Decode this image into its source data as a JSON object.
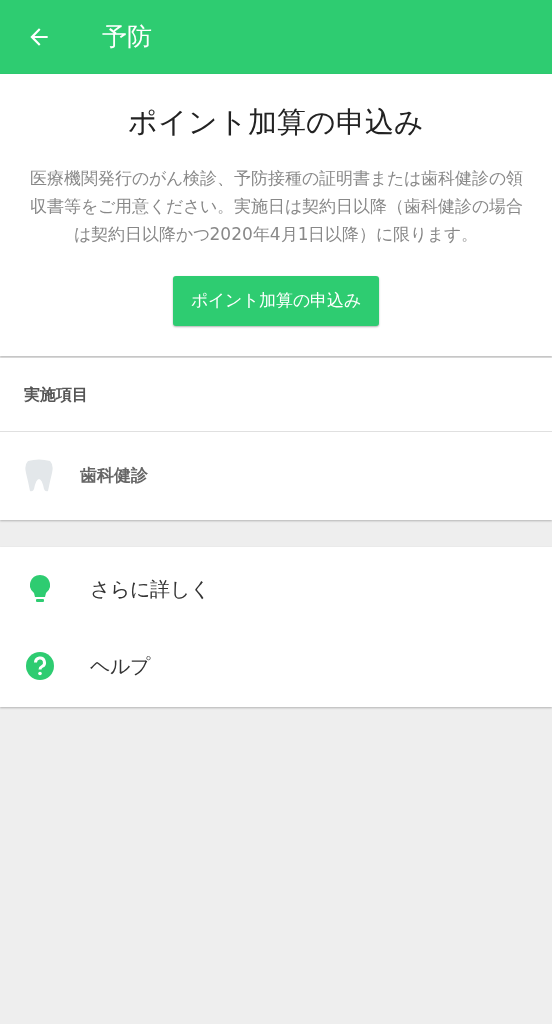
{
  "header": {
    "title": "予防"
  },
  "application": {
    "title": "ポイント加算の申込み",
    "description": "医療機関発行のがん検診、予防接種の証明書または歯科健診の領収書等をご用意ください。実施日は契約日以降（歯科健診の場合は契約日以降かつ2020年4月1日以降）に限ります。",
    "button": "ポイント加算の申込み"
  },
  "items_section": {
    "heading": "実施項目",
    "items": [
      {
        "label": "歯科健診"
      }
    ]
  },
  "menu": [
    {
      "kind": "tip",
      "label": "さらに詳しく"
    },
    {
      "kind": "help",
      "label": "ヘルプ"
    }
  ]
}
